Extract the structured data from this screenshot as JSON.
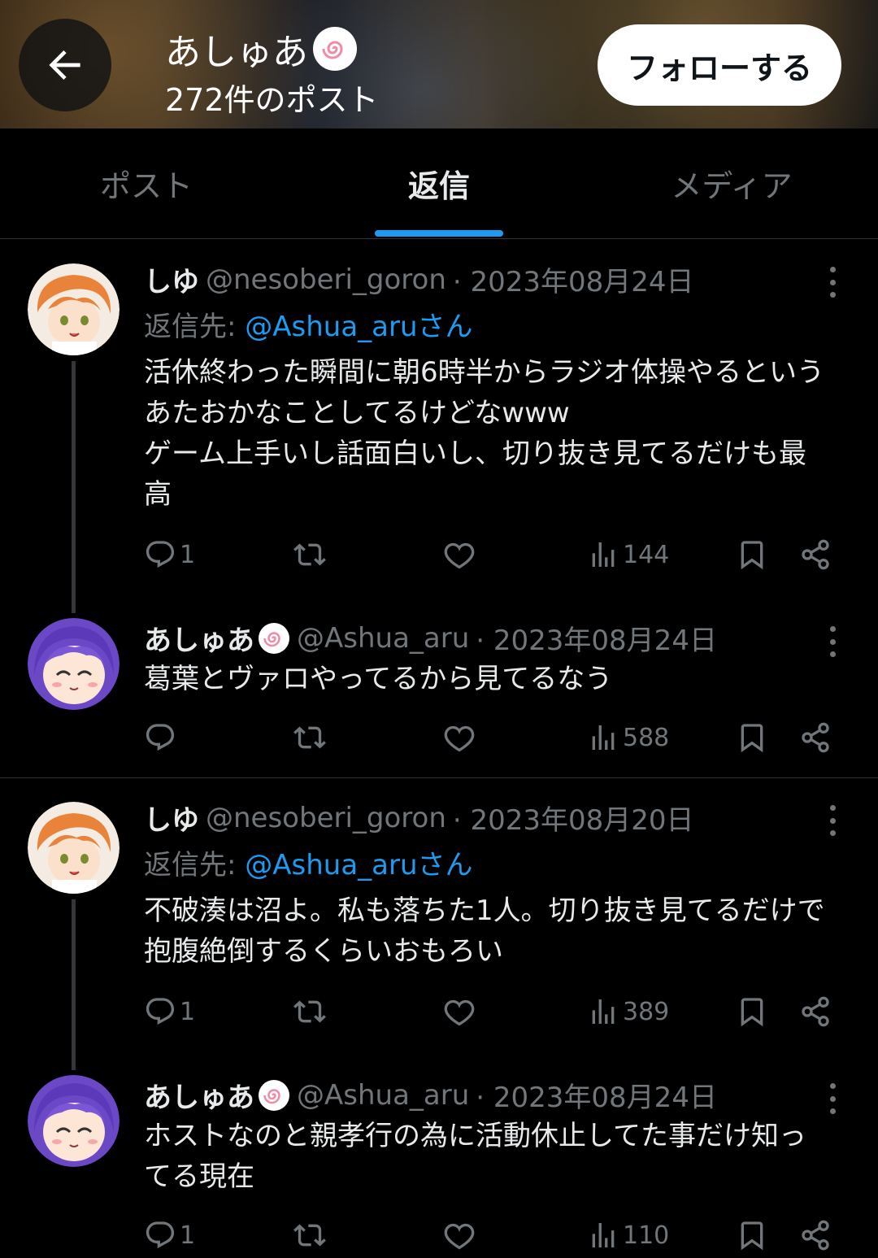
{
  "header": {
    "title": "あしゅあ",
    "post_count": "272件のポスト",
    "follow_label": "フォローする"
  },
  "tabs": [
    {
      "label": "ポスト",
      "active": false
    },
    {
      "label": "返信",
      "active": true
    },
    {
      "label": "メディア",
      "active": false
    }
  ],
  "posts": [
    {
      "name": "しゆ",
      "handle": "@nesoberi_goron",
      "date": "· 2023年08月24日",
      "reply_prefix": "返信先: ",
      "reply_to": "@Ashua_aruさん",
      "text": "活休終わった瞬間に朝6時半からラジオ体操やるという\nあたおかなことしてるけどなwww\nゲーム上手いし話面白いし、切り抜き見てるだけも最\n高",
      "replies": "1",
      "views": "144"
    },
    {
      "name": "あしゅあ",
      "handle": "@Ashua_aru",
      "date": "· 2023年08月24日",
      "text": "葛葉とヴァロやってるから見てるなう",
      "replies": "",
      "views": "588"
    },
    {
      "name": "しゆ",
      "handle": "@nesoberi_goron",
      "date": "· 2023年08月20日",
      "reply_prefix": "返信先: ",
      "reply_to": "@Ashua_aruさん",
      "text": "不破湊は沼よ。私も落ちた1人。切り抜き見てるだけで\n抱腹絶倒するくらいおもろい",
      "replies": "1",
      "views": "389"
    },
    {
      "name": "あしゅあ",
      "handle": "@Ashua_aru",
      "date": "· 2023年08月24日",
      "text": "ホストなのと親孝行の為に活動休止してた事だけ知っ\nてる現在",
      "replies": "1",
      "views": "110"
    }
  ],
  "colors": {
    "accent": "#1d9bf0",
    "muted": "#71767b",
    "background": "#000000"
  },
  "icons": [
    "back-arrow-icon",
    "naruto-emoji-icon",
    "reply-icon",
    "repost-icon",
    "like-icon",
    "views-icon",
    "bookmark-icon",
    "share-icon",
    "more-icon"
  ]
}
